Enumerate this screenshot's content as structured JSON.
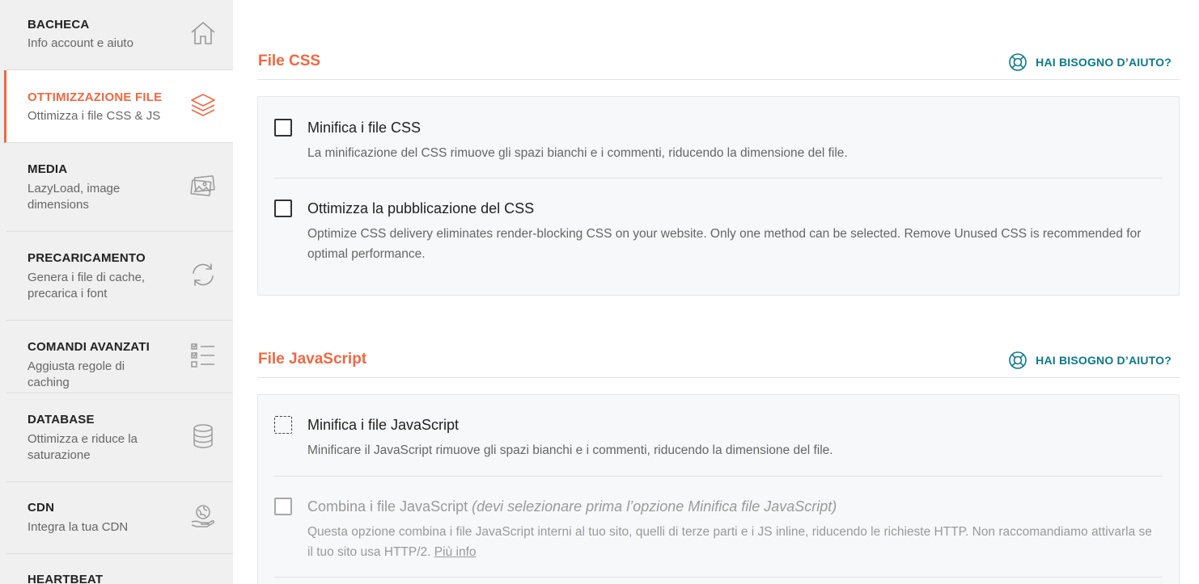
{
  "sidebar": {
    "items": [
      {
        "title": "BACHECA",
        "subtitle": "Info account e aiuto",
        "icon": "home-icon"
      },
      {
        "title": "OTTIMIZZAZIONE FILE",
        "subtitle": "Ottimizza i file CSS & JS",
        "icon": "layers-icon",
        "active": true
      },
      {
        "title": "MEDIA",
        "subtitle": "LazyLoad, image dimensions",
        "icon": "images-icon"
      },
      {
        "title": "PRECARICAMENTO",
        "subtitle": "Genera i file di cache, precarica i font",
        "icon": "refresh-icon"
      },
      {
        "title": "COMANDI AVANZATI",
        "subtitle": "Aggiusta regole di caching",
        "icon": "checklist-icon"
      },
      {
        "title": "DATABASE",
        "subtitle": "Ottimizza e riduce la saturazione",
        "icon": "database-icon"
      },
      {
        "title": "CDN",
        "subtitle": "Integra la tua CDN",
        "icon": "globe-hand-icon"
      },
      {
        "title": "HEARTBEAT",
        "subtitle": "",
        "icon": ""
      }
    ]
  },
  "accent_color": "#f56640",
  "link_color": "#0b7a8a",
  "css_section": {
    "title": "File CSS",
    "help_label": "HAI BISOGNO D’AIUTO?",
    "options": [
      {
        "label": "Minifica i file CSS",
        "description": "La minificazione del CSS rimuove gli spazi bianchi e i commenti, riducendo la dimensione del file.",
        "checked": false
      },
      {
        "label": "Ottimizza la pubblicazione del CSS",
        "description": "Optimize CSS delivery eliminates render-blocking CSS on your website. Only one method can be selected. Remove Unused CSS is recommended for optimal performance.",
        "checked": false
      }
    ]
  },
  "js_section": {
    "title": "File JavaScript",
    "help_label": "HAI BISOGNO D’AIUTO?",
    "options": [
      {
        "label": "Minifica i file JavaScript",
        "description": "Minificare il JavaScript rimuove gli spazi bianchi e i commenti, riducendo la dimensione del file.",
        "checked": false
      },
      {
        "label": "Combina i file JavaScript",
        "label_note": "(devi selezionare prima l’opzione Minifica file JavaScript)",
        "description": "Questa opzione combina i file JavaScript interni al tuo sito, quelli di terze parti e i JS inline, riducendo le richieste HTTP. Non raccomandiamo attivarla se il tuo sito usa HTTP/2.",
        "more_link": "Più info",
        "checked": false,
        "disabled": true
      }
    ]
  }
}
